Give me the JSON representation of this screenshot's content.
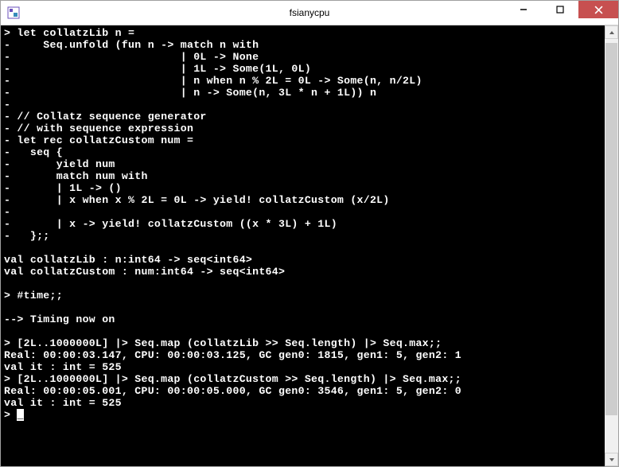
{
  "window": {
    "title": "fsianycpu"
  },
  "terminal": {
    "lines": [
      "> let collatzLib n =",
      "-     Seq.unfold (fun n -> match n with",
      "-                          | 0L -> None",
      "-                          | 1L -> Some(1L, 0L)",
      "-                          | n when n % 2L = 0L -> Some(n, n/2L)",
      "-                          | n -> Some(n, 3L * n + 1L)) n",
      "-",
      "- // Collatz sequence generator",
      "- // with sequence expression",
      "- let rec collatzCustom num =",
      "-   seq {",
      "-       yield num",
      "-       match num with",
      "-       | 1L -> ()",
      "-       | x when x % 2L = 0L -> yield! collatzCustom (x/2L)",
      "-",
      "-       | x -> yield! collatzCustom ((x * 3L) + 1L)",
      "-   };;",
      "",
      "val collatzLib : n:int64 -> seq<int64>",
      "val collatzCustom : num:int64 -> seq<int64>",
      "",
      "> #time;;",
      "",
      "--> Timing now on",
      "",
      "> [2L..1000000L] |> Seq.map (collatzLib >> Seq.length) |> Seq.max;;",
      "Real: 00:00:03.147, CPU: 00:00:03.125, GC gen0: 1815, gen1: 5, gen2: 1",
      "val it : int = 525",
      "> [2L..1000000L] |> Seq.map (collatzCustom >> Seq.length) |> Seq.max;;",
      "Real: 00:00:05.001, CPU: 00:00:05.000, GC gen0: 3546, gen1: 5, gen2: 0",
      "val it : int = 525",
      "> "
    ],
    "cursor": "_"
  }
}
